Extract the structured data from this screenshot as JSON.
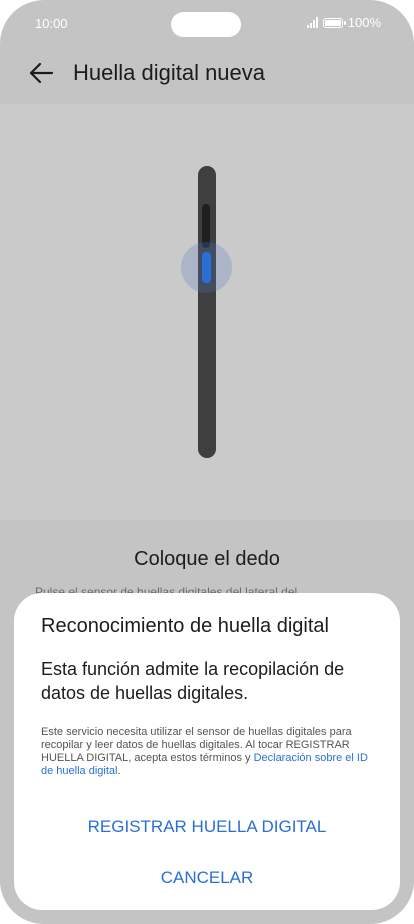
{
  "status_bar": {
    "time": "10:00",
    "battery": "100%"
  },
  "app_bar": {
    "title": "Huella digital nueva"
  },
  "main": {
    "heading": "Coloque el dedo",
    "hint": "Pulse el sensor de huellas digitales del lateral del"
  },
  "dialog": {
    "title": "Reconocimiento de huella digital",
    "body": "Esta función admite la recopilación de datos de huellas digitales.",
    "fine_print": "Este servicio necesita utilizar el sensor de huellas digitales para recopilar y leer datos de huellas digitales. Al tocar REGISTRAR HUELLA DIGITAL, acepta estos términos y ",
    "policy_link": "Declaración sobre el ID de huella digital",
    "fine_print_end": ".",
    "register_button": "REGISTRAR HUELLA DIGITAL",
    "cancel_button": "CANCELAR"
  },
  "colors": {
    "accent": "#2a6fd6",
    "scrim": "#c4c4c4",
    "dialog_bg": "#ffffff"
  }
}
